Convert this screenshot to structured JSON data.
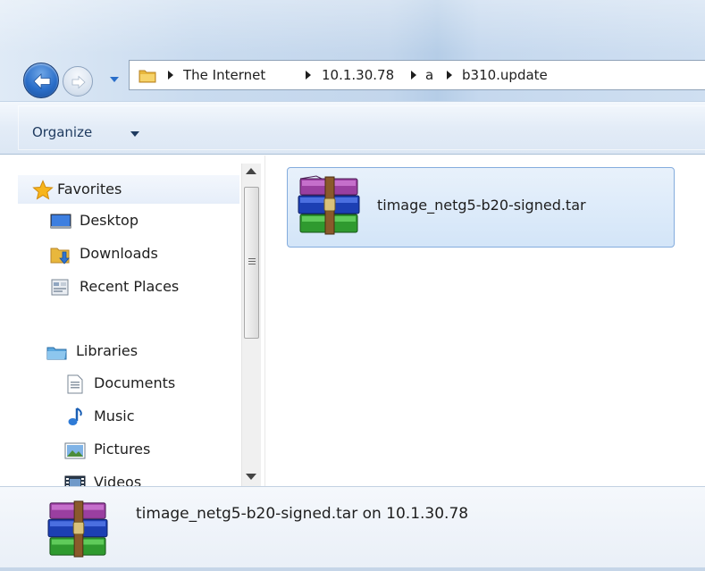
{
  "window": {
    "breadcrumb": [
      "The Internet",
      "10.1.30.78",
      "a",
      "b310.update"
    ]
  },
  "toolbar": {
    "organize_label": "Organize"
  },
  "nav_pane": {
    "favorites": {
      "label": "Favorites",
      "icon": "star-icon",
      "items": [
        {
          "label": "Desktop",
          "icon": "desktop-icon"
        },
        {
          "label": "Downloads",
          "icon": "downloads-folder-icon"
        },
        {
          "label": "Recent Places",
          "icon": "recent-places-icon"
        }
      ]
    },
    "libraries": {
      "label": "Libraries",
      "icon": "libraries-icon",
      "items": [
        {
          "label": "Documents",
          "icon": "documents-icon"
        },
        {
          "label": "Music",
          "icon": "music-icon"
        },
        {
          "label": "Pictures",
          "icon": "pictures-icon"
        },
        {
          "label": "Videos",
          "icon": "videos-icon"
        }
      ]
    }
  },
  "files": [
    {
      "name": "timage_netg5-b20-signed.tar",
      "icon": "winrar-archive-icon",
      "selected": true
    }
  ],
  "details_pane": {
    "text": "timage_netg5-b20-signed.tar on 10.1.30.78",
    "icon": "winrar-archive-icon"
  }
}
